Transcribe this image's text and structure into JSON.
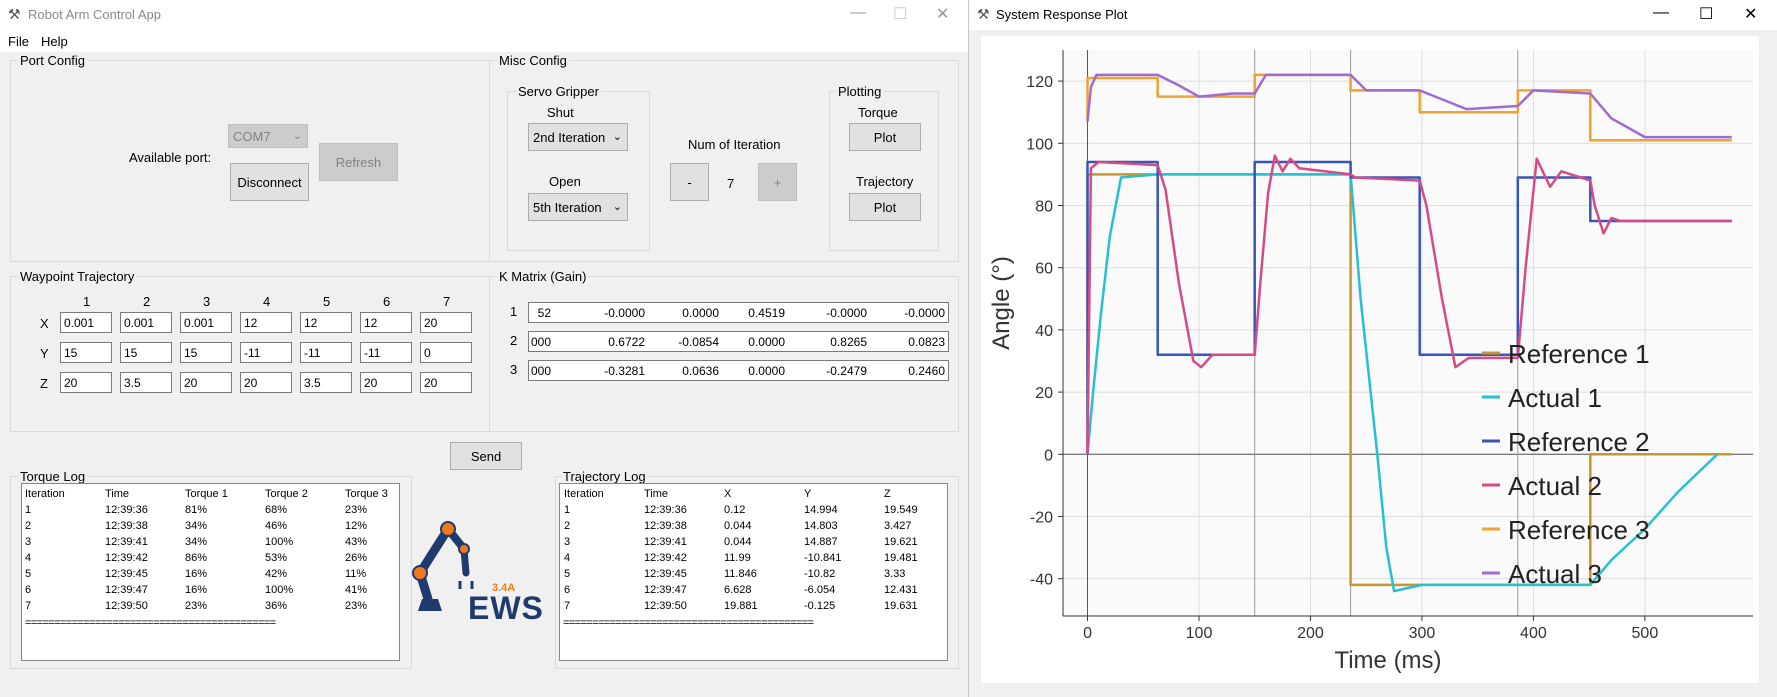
{
  "left_window": {
    "title": "Robot Arm Control App",
    "menu": [
      "File",
      "Help"
    ],
    "port_config": {
      "label": "Port Config",
      "available_port_label": "Available port:",
      "port_value": "COM7",
      "refresh": "Refresh",
      "disconnect": "Disconnect"
    },
    "misc_config": {
      "label": "Misc Config",
      "servo_gripper": "Servo Gripper",
      "shut_label": "Shut",
      "shut_value": "2nd Iteration",
      "open_label": "Open",
      "open_value": "5th Iteration",
      "num_iteration_label": "Num of Iteration",
      "minus": "-",
      "num_value": "7",
      "plus": "+",
      "plotting": "Plotting",
      "torque_label": "Torque",
      "plot_torque": "Plot",
      "trajectory_label": "Trajectory",
      "plot_trajectory": "Plot"
    },
    "waypoint": {
      "label": "Waypoint Trajectory",
      "columns": [
        "1",
        "2",
        "3",
        "4",
        "5",
        "6",
        "7"
      ],
      "rows": [
        {
          "label": "X",
          "values": [
            "0.001",
            "0.001",
            "0.001",
            "12",
            "12",
            "12",
            "20"
          ]
        },
        {
          "label": "Y",
          "values": [
            "15",
            "15",
            "15",
            "-11",
            "-11",
            "-11",
            "0"
          ]
        },
        {
          "label": "Z",
          "values": [
            "20",
            "3.5",
            "20",
            "20",
            "3.5",
            "20",
            "20"
          ]
        }
      ]
    },
    "kmatrix": {
      "label": "K Matrix (Gain)",
      "rows": [
        {
          "label": "1",
          "values": [
            "52",
            "-0.0000",
            "0.0000",
            "0.4519",
            "-0.0000",
            "-0.0000"
          ]
        },
        {
          "label": "2",
          "values": "000|0.6722|-0.0854|0.0000|0.8265|0.0823"
        },
        {
          "label": "3",
          "values": "000|-0.3281|0.0636|0.0000|-0.2479|0.2460"
        }
      ]
    },
    "send": "Send",
    "torque_log": {
      "label": "Torque Log",
      "headers": [
        "Iteration",
        "Time",
        "Torque 1",
        "Torque 2",
        "Torque 3"
      ],
      "rows": [
        [
          "1",
          "12:39:36",
          "81%",
          "68%",
          "23%"
        ],
        [
          "2",
          "12:39:38",
          "34%",
          "46%",
          "12%"
        ],
        [
          "3",
          "12:39:41",
          "34%",
          "100%",
          "43%"
        ],
        [
          "4",
          "12:39:42",
          "86%",
          "53%",
          "26%"
        ],
        [
          "5",
          "12:39:45",
          "16%",
          "42%",
          "11%"
        ],
        [
          "6",
          "12:39:47",
          "16%",
          "100%",
          "41%"
        ],
        [
          "7",
          "12:39:50",
          "23%",
          "36%",
          "23%"
        ]
      ],
      "separator": "==========================================="
    },
    "trajectory_log": {
      "label": "Trajectory Log",
      "headers": [
        "Iteration",
        "Time",
        "X",
        "Y",
        "Z"
      ],
      "rows": [
        [
          "1",
          "12:39:36",
          "0.12",
          "14.994",
          "19.549"
        ],
        [
          "2",
          "12:39:38",
          "0.044",
          "14.803",
          "3.427"
        ],
        [
          "3",
          "12:39:41",
          "0.044",
          "14.887",
          "19.621"
        ],
        [
          "4",
          "12:39:42",
          "11.99",
          "-10.841",
          "19.481"
        ],
        [
          "5",
          "12:39:45",
          "11.846",
          "-10.82",
          "3.33"
        ],
        [
          "6",
          "12:39:47",
          "6.628",
          "-6.054",
          "12.431"
        ],
        [
          "7",
          "12:39:50",
          "19.881",
          "-0.125",
          "19.631"
        ]
      ],
      "separator": "==========================================="
    },
    "logo": {
      "text": "EWS",
      "sup": "3.4A"
    }
  },
  "right_window": {
    "title": "System Response Plot"
  },
  "chart_data": {
    "type": "line",
    "xlabel": "Time (ms)",
    "ylabel": "Angle (°)",
    "xlim": [
      -22,
      597
    ],
    "ylim": [
      -52,
      130
    ],
    "xticks": [
      0,
      100,
      200,
      300,
      400,
      500
    ],
    "yticks": [
      120,
      100,
      80,
      60,
      40,
      20,
      0,
      -20,
      -40
    ],
    "grid": true,
    "legend_position": "right",
    "series": [
      {
        "name": "Reference 1",
        "color": "#c8952e",
        "x": [
          0,
          0,
          63,
          63,
          150,
          150,
          236,
          236,
          298,
          298,
          386,
          386,
          451,
          451,
          578
        ],
        "y": [
          0,
          90,
          90,
          90,
          90,
          90,
          90,
          -42,
          -42,
          -42,
          -42,
          -42,
          -42,
          0,
          0
        ]
      },
      {
        "name": "Actual 1",
        "color": "#26c0d0",
        "x": [
          0,
          5,
          12,
          20,
          30,
          63,
          150,
          236,
          245,
          260,
          268,
          275,
          300,
          386,
          451,
          470,
          500,
          530,
          565
        ],
        "y": [
          0,
          20,
          45,
          70,
          89,
          90,
          90,
          90,
          50,
          0,
          -30,
          -44,
          -42,
          -42,
          -42,
          -34,
          -24,
          -12,
          0
        ]
      },
      {
        "name": "Reference 2",
        "color": "#3a55b8",
        "x": [
          0,
          0,
          63,
          63,
          150,
          150,
          236,
          236,
          298,
          298,
          386,
          386,
          451,
          451,
          578
        ],
        "y": [
          0,
          94,
          94,
          32,
          32,
          94,
          94,
          89,
          89,
          32,
          32,
          89,
          89,
          75,
          75
        ]
      },
      {
        "name": "Actual 2",
        "color": "#d64a86",
        "x": [
          0,
          3,
          10,
          63,
          70,
          82,
          95,
          102,
          112,
          130,
          150,
          155,
          162,
          168,
          175,
          182,
          190,
          236,
          240,
          298,
          304,
          318,
          330,
          342,
          386,
          393,
          403,
          415,
          425,
          451,
          455,
          463,
          470,
          478,
          578
        ],
        "y": [
          0,
          92,
          94,
          93,
          85,
          55,
          30,
          28,
          32,
          32,
          32,
          55,
          84,
          96,
          91,
          95,
          92,
          90,
          89,
          88,
          80,
          50,
          28,
          31,
          31,
          60,
          95,
          86,
          91,
          88,
          80,
          71,
          76,
          75,
          75
        ]
      },
      {
        "name": "Reference 3",
        "color": "#f0a330",
        "x": [
          0,
          0,
          63,
          63,
          150,
          150,
          236,
          236,
          298,
          298,
          386,
          386,
          451,
          451,
          578
        ],
        "y": [
          107,
          121,
          121,
          115,
          115,
          122,
          122,
          117,
          117,
          110,
          110,
          117,
          117,
          101,
          101
        ]
      },
      {
        "name": "Actual 3",
        "color": "#a06ad0",
        "x": [
          0,
          3,
          8,
          20,
          63,
          80,
          100,
          130,
          150,
          160,
          236,
          250,
          298,
          340,
          386,
          400,
          451,
          470,
          500,
          578
        ],
        "y": [
          107,
          118,
          122,
          122,
          122,
          119,
          115,
          116,
          116,
          122,
          122,
          117,
          117,
          111,
          112,
          117,
          116,
          108,
          102,
          102
        ]
      }
    ]
  }
}
